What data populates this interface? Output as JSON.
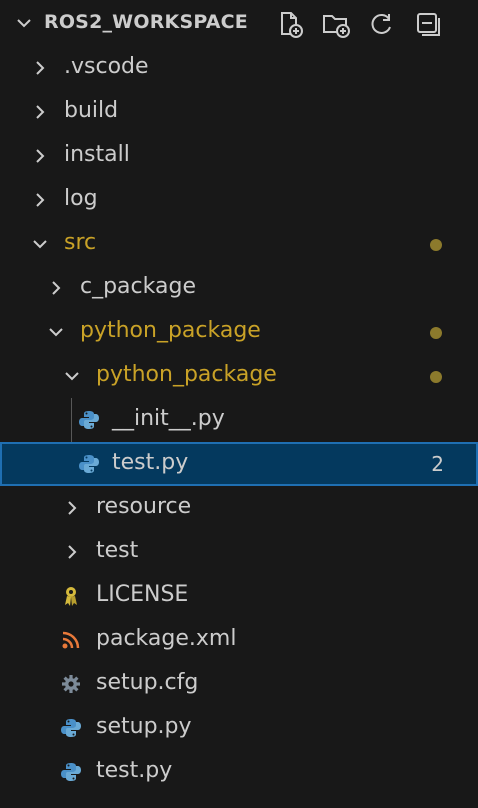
{
  "explorer": {
    "title": "ROS2_WORKSPACE",
    "actions": [
      {
        "name": "new-file-icon"
      },
      {
        "name": "new-folder-icon"
      },
      {
        "name": "refresh-icon"
      },
      {
        "name": "collapse-all-icon"
      }
    ]
  },
  "tree": [
    {
      "label": ".vscode",
      "type": "folder",
      "expanded": false,
      "depth": 0
    },
    {
      "label": "build",
      "type": "folder",
      "expanded": false,
      "depth": 0
    },
    {
      "label": "install",
      "type": "folder",
      "expanded": false,
      "depth": 0
    },
    {
      "label": "log",
      "type": "folder",
      "expanded": false,
      "depth": 0
    },
    {
      "label": "src",
      "type": "folder",
      "expanded": true,
      "depth": 0,
      "modified": true
    },
    {
      "label": "c_package",
      "type": "folder",
      "expanded": false,
      "depth": 1
    },
    {
      "label": "python_package",
      "type": "folder",
      "expanded": true,
      "depth": 1,
      "modified": true
    },
    {
      "label": "python_package",
      "type": "folder",
      "expanded": true,
      "depth": 2,
      "modified": true
    },
    {
      "label": "__init__.py",
      "type": "python",
      "depth": 3
    },
    {
      "label": "test.py",
      "type": "python",
      "depth": 3,
      "selected": true,
      "badge": "2"
    },
    {
      "label": "resource",
      "type": "folder",
      "expanded": false,
      "depth": 2
    },
    {
      "label": "test",
      "type": "folder",
      "expanded": false,
      "depth": 2
    },
    {
      "label": "LICENSE",
      "type": "license",
      "depth": 2
    },
    {
      "label": "package.xml",
      "type": "rss",
      "depth": 2
    },
    {
      "label": "setup.cfg",
      "type": "gear",
      "depth": 2
    },
    {
      "label": "setup.py",
      "type": "python",
      "depth": 2
    },
    {
      "label": "test.py",
      "type": "python",
      "depth": 2
    }
  ],
  "colors": {
    "background": "#181818",
    "text": "#cccccc",
    "modified": "#c9a227",
    "selection": "#04395e",
    "selection_border": "#1f6fb2",
    "python_blue": "#4a90c8",
    "license_yellow": "#d4b93c",
    "rss_orange": "#e8793a",
    "gear_gray": "#7d8b99"
  }
}
